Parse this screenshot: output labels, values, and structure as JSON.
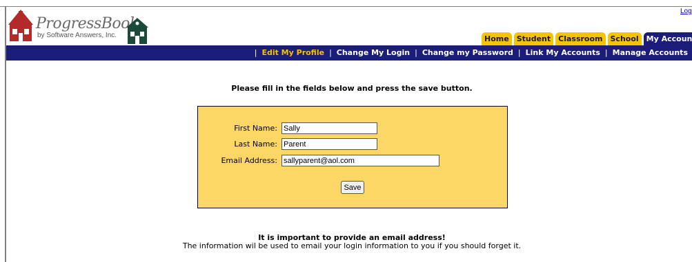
{
  "brand": {
    "name": "ProgressBook",
    "tagline": "by Software Answers, Inc."
  },
  "header": {
    "logout": "Logout"
  },
  "tabs": [
    {
      "label": "Home",
      "active": false
    },
    {
      "label": "Student",
      "active": false
    },
    {
      "label": "Classroom",
      "active": false
    },
    {
      "label": "School",
      "active": false
    },
    {
      "label": "My Account",
      "active": true
    }
  ],
  "subnav": [
    {
      "label": "Edit My Profile",
      "current": true
    },
    {
      "label": "Change My Login",
      "current": false
    },
    {
      "label": "Change my Password",
      "current": false
    },
    {
      "label": "Link My Accounts",
      "current": false
    },
    {
      "label": "Manage Accounts",
      "current": false
    }
  ],
  "instructions": "Please fill in the fields below and press the save button.",
  "form": {
    "first_name": {
      "label": "First Name:",
      "value": "Sally"
    },
    "last_name": {
      "label": "Last Name:",
      "value": "Parent"
    },
    "email": {
      "label": "Email Address:",
      "value": "sallyparent@aol.com"
    },
    "save_label": "Save"
  },
  "notice": {
    "title": "It is important to provide an email address!",
    "body": "The information wil be used to email your login information to you if you should forget it."
  },
  "colors": {
    "nav_bg": "#1c1c7a",
    "tab_bg": "#f6c300",
    "form_bg": "#fcd766",
    "current_link": "#f6c300"
  }
}
